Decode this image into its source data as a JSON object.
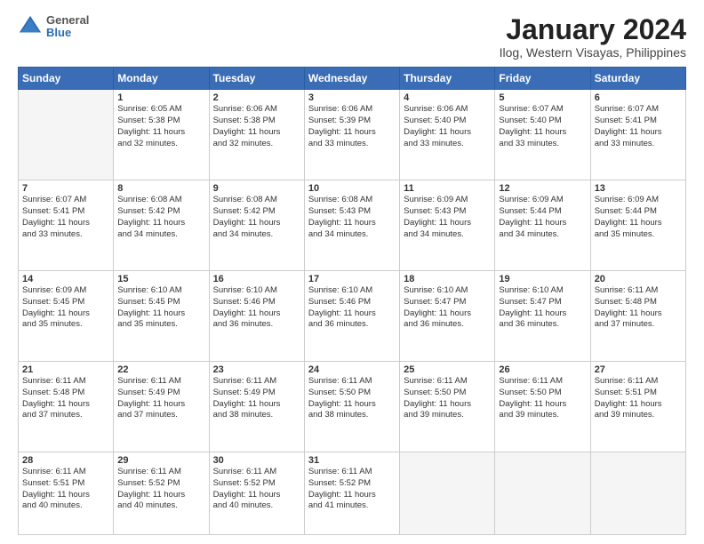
{
  "header": {
    "logo": {
      "general": "General",
      "blue": "Blue"
    },
    "title": "January 2024",
    "subtitle": "Ilog, Western Visayas, Philippines"
  },
  "days_of_week": [
    "Sunday",
    "Monday",
    "Tuesday",
    "Wednesday",
    "Thursday",
    "Friday",
    "Saturday"
  ],
  "weeks": [
    [
      {
        "day": "",
        "info": ""
      },
      {
        "day": "1",
        "info": "Sunrise: 6:05 AM\nSunset: 5:38 PM\nDaylight: 11 hours\nand 32 minutes."
      },
      {
        "day": "2",
        "info": "Sunrise: 6:06 AM\nSunset: 5:38 PM\nDaylight: 11 hours\nand 32 minutes."
      },
      {
        "day": "3",
        "info": "Sunrise: 6:06 AM\nSunset: 5:39 PM\nDaylight: 11 hours\nand 33 minutes."
      },
      {
        "day": "4",
        "info": "Sunrise: 6:06 AM\nSunset: 5:40 PM\nDaylight: 11 hours\nand 33 minutes."
      },
      {
        "day": "5",
        "info": "Sunrise: 6:07 AM\nSunset: 5:40 PM\nDaylight: 11 hours\nand 33 minutes."
      },
      {
        "day": "6",
        "info": "Sunrise: 6:07 AM\nSunset: 5:41 PM\nDaylight: 11 hours\nand 33 minutes."
      }
    ],
    [
      {
        "day": "7",
        "info": "Sunrise: 6:07 AM\nSunset: 5:41 PM\nDaylight: 11 hours\nand 33 minutes."
      },
      {
        "day": "8",
        "info": "Sunrise: 6:08 AM\nSunset: 5:42 PM\nDaylight: 11 hours\nand 34 minutes."
      },
      {
        "day": "9",
        "info": "Sunrise: 6:08 AM\nSunset: 5:42 PM\nDaylight: 11 hours\nand 34 minutes."
      },
      {
        "day": "10",
        "info": "Sunrise: 6:08 AM\nSunset: 5:43 PM\nDaylight: 11 hours\nand 34 minutes."
      },
      {
        "day": "11",
        "info": "Sunrise: 6:09 AM\nSunset: 5:43 PM\nDaylight: 11 hours\nand 34 minutes."
      },
      {
        "day": "12",
        "info": "Sunrise: 6:09 AM\nSunset: 5:44 PM\nDaylight: 11 hours\nand 34 minutes."
      },
      {
        "day": "13",
        "info": "Sunrise: 6:09 AM\nSunset: 5:44 PM\nDaylight: 11 hours\nand 35 minutes."
      }
    ],
    [
      {
        "day": "14",
        "info": "Sunrise: 6:09 AM\nSunset: 5:45 PM\nDaylight: 11 hours\nand 35 minutes."
      },
      {
        "day": "15",
        "info": "Sunrise: 6:10 AM\nSunset: 5:45 PM\nDaylight: 11 hours\nand 35 minutes."
      },
      {
        "day": "16",
        "info": "Sunrise: 6:10 AM\nSunset: 5:46 PM\nDaylight: 11 hours\nand 36 minutes."
      },
      {
        "day": "17",
        "info": "Sunrise: 6:10 AM\nSunset: 5:46 PM\nDaylight: 11 hours\nand 36 minutes."
      },
      {
        "day": "18",
        "info": "Sunrise: 6:10 AM\nSunset: 5:47 PM\nDaylight: 11 hours\nand 36 minutes."
      },
      {
        "day": "19",
        "info": "Sunrise: 6:10 AM\nSunset: 5:47 PM\nDaylight: 11 hours\nand 36 minutes."
      },
      {
        "day": "20",
        "info": "Sunrise: 6:11 AM\nSunset: 5:48 PM\nDaylight: 11 hours\nand 37 minutes."
      }
    ],
    [
      {
        "day": "21",
        "info": "Sunrise: 6:11 AM\nSunset: 5:48 PM\nDaylight: 11 hours\nand 37 minutes."
      },
      {
        "day": "22",
        "info": "Sunrise: 6:11 AM\nSunset: 5:49 PM\nDaylight: 11 hours\nand 37 minutes."
      },
      {
        "day": "23",
        "info": "Sunrise: 6:11 AM\nSunset: 5:49 PM\nDaylight: 11 hours\nand 38 minutes."
      },
      {
        "day": "24",
        "info": "Sunrise: 6:11 AM\nSunset: 5:50 PM\nDaylight: 11 hours\nand 38 minutes."
      },
      {
        "day": "25",
        "info": "Sunrise: 6:11 AM\nSunset: 5:50 PM\nDaylight: 11 hours\nand 39 minutes."
      },
      {
        "day": "26",
        "info": "Sunrise: 6:11 AM\nSunset: 5:50 PM\nDaylight: 11 hours\nand 39 minutes."
      },
      {
        "day": "27",
        "info": "Sunrise: 6:11 AM\nSunset: 5:51 PM\nDaylight: 11 hours\nand 39 minutes."
      }
    ],
    [
      {
        "day": "28",
        "info": "Sunrise: 6:11 AM\nSunset: 5:51 PM\nDaylight: 11 hours\nand 40 minutes."
      },
      {
        "day": "29",
        "info": "Sunrise: 6:11 AM\nSunset: 5:52 PM\nDaylight: 11 hours\nand 40 minutes."
      },
      {
        "day": "30",
        "info": "Sunrise: 6:11 AM\nSunset: 5:52 PM\nDaylight: 11 hours\nand 40 minutes."
      },
      {
        "day": "31",
        "info": "Sunrise: 6:11 AM\nSunset: 5:52 PM\nDaylight: 11 hours\nand 41 minutes."
      },
      {
        "day": "",
        "info": ""
      },
      {
        "day": "",
        "info": ""
      },
      {
        "day": "",
        "info": ""
      }
    ]
  ]
}
